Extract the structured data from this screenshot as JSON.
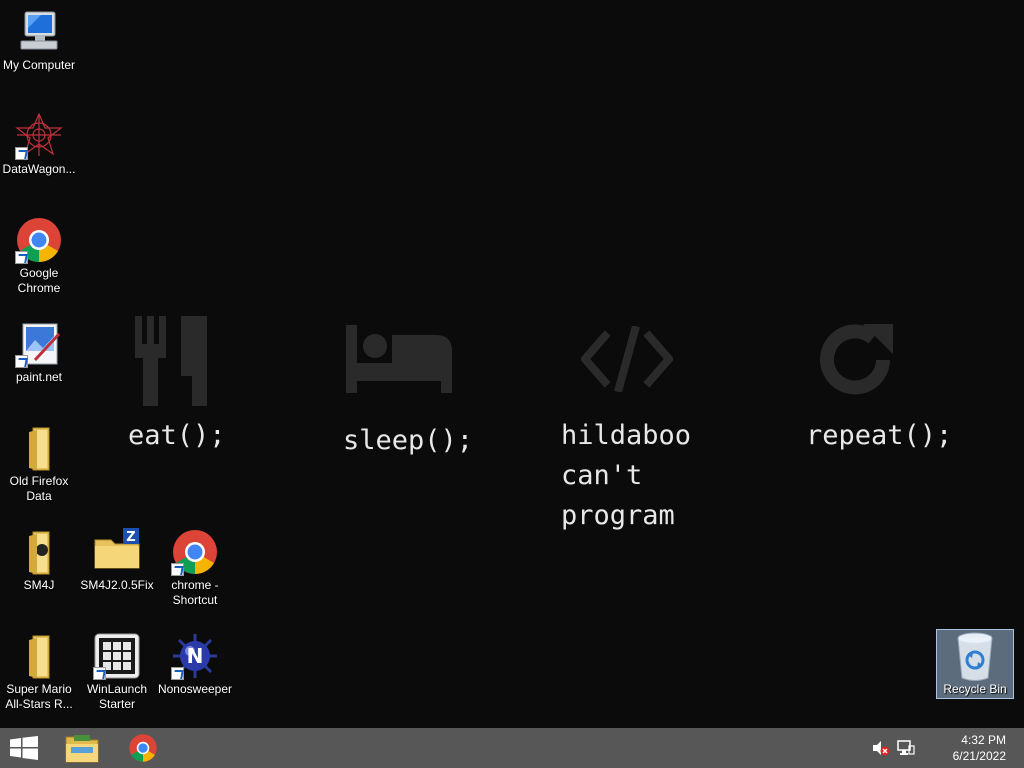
{
  "desktop": {
    "icons": [
      {
        "label": "My Computer",
        "name": "my-computer-icon"
      },
      {
        "label": "DataWagon...",
        "name": "datawagon-icon"
      },
      {
        "label": "Google Chrome",
        "name": "google-chrome-icon"
      },
      {
        "label": "paint.net",
        "name": "paint-net-icon"
      },
      {
        "label": "Old Firefox Data",
        "name": "folder-icon"
      },
      {
        "label": "SM4J",
        "name": "folder-icon"
      },
      {
        "label": "SM4J2.0.5Fix",
        "name": "zip-folder-icon"
      },
      {
        "label": "chrome - Shortcut",
        "name": "google-chrome-icon"
      },
      {
        "label": "Super Mario All-Stars R...",
        "name": "folder-icon"
      },
      {
        "label": "WinLaunch Starter",
        "name": "winlaunch-icon"
      },
      {
        "label": "Nonosweeper",
        "name": "nonosweeper-icon"
      }
    ],
    "recycle_bin": {
      "label": "Recycle Bin"
    }
  },
  "wallpaper": {
    "items": [
      {
        "icon": "fork-knife-icon",
        "text": "eat();"
      },
      {
        "icon": "bed-icon",
        "text": "sleep();"
      },
      {
        "icon": "code-icon",
        "text": "hildaboo\ncan't\nprogram"
      },
      {
        "icon": "repeat-icon",
        "text": "repeat();"
      }
    ]
  },
  "taskbar": {
    "start": "windows-logo-icon",
    "pinned": [
      "file-explorer-icon",
      "google-chrome-icon"
    ],
    "tray": [
      "volume-muted-icon",
      "network-icon"
    ],
    "time": "4:32 PM",
    "date": "6/21/2022"
  },
  "colors": {
    "desktop_bg": "#0b0b0b",
    "taskbar_bg": "#575757",
    "wallpaper_glyph": "#2a2a2a",
    "wallpaper_text": "#e8e8e8"
  }
}
